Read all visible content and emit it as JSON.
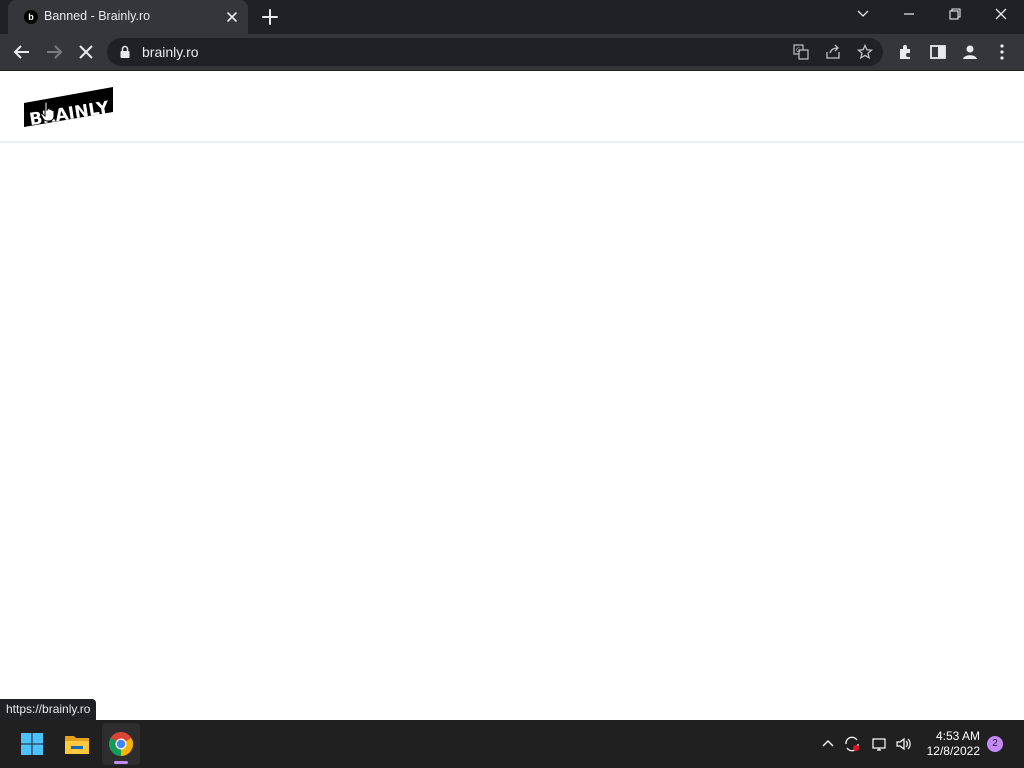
{
  "browser": {
    "tab": {
      "title": "Banned - Brainly.ro",
      "favicon_icon": "brainly-favicon-icon"
    },
    "address_bar": {
      "url": "brainly.ro"
    },
    "status_url": "https://brainly.ro"
  },
  "page": {
    "logo_text": "BRAINLY"
  },
  "taskbar": {
    "time": "4:53 AM",
    "date": "12/8/2022",
    "notifications": "2"
  },
  "colors": {
    "tabstrip_bg": "#202124",
    "toolbar_bg": "#35363a",
    "taskbar_bg": "#202020",
    "notification_badge": "#c58af9"
  }
}
